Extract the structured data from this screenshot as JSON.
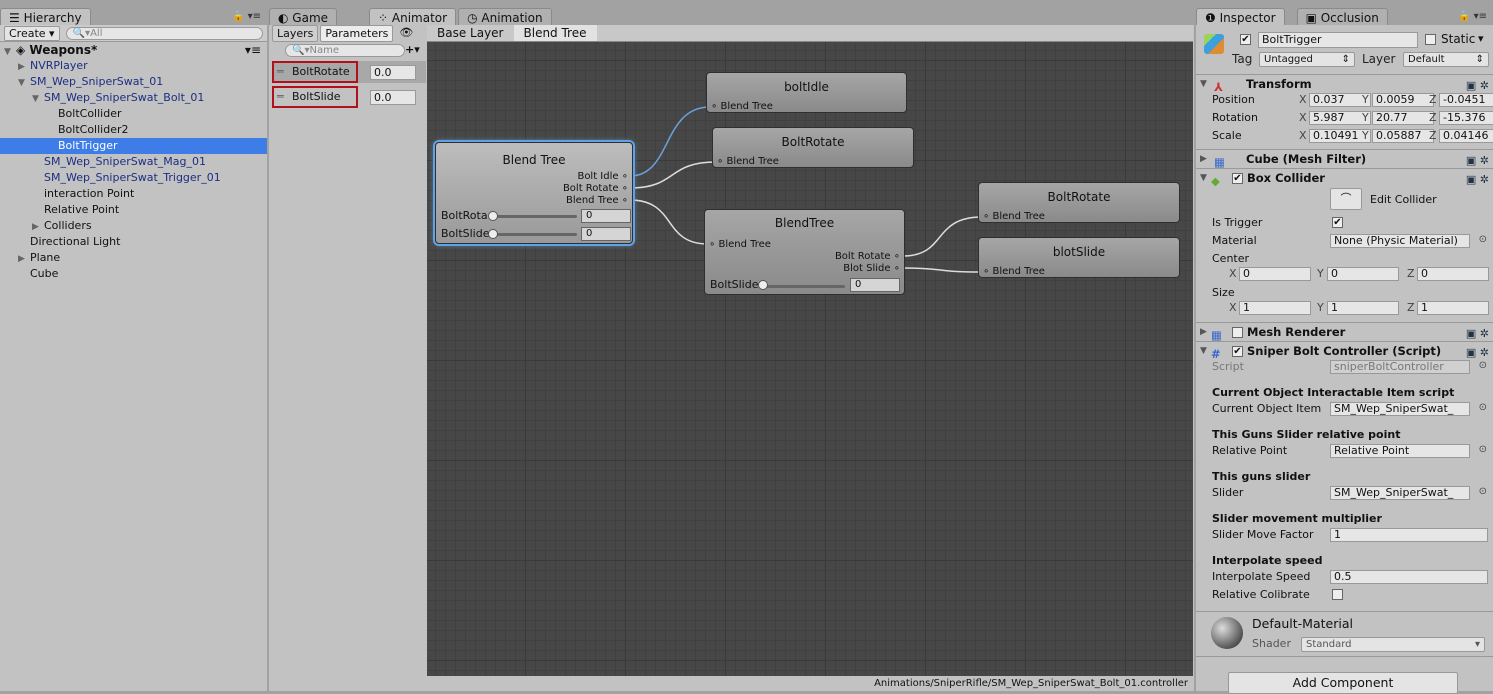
{
  "hierarchy": {
    "tab": "Hierarchy",
    "create": "Create",
    "search_placeholder": "All",
    "scene": "Weapons*",
    "items": [
      {
        "label": "NVRPlayer",
        "blue": true
      },
      {
        "label": "SM_Wep_SniperSwat_01",
        "blue": true
      },
      {
        "label": "SM_Wep_SniperSwat_Bolt_01",
        "blue": true
      },
      {
        "label": "BoltCollider"
      },
      {
        "label": "BoltCollider2"
      },
      {
        "label": "BoltTrigger",
        "selected": true
      },
      {
        "label": "SM_Wep_SniperSwat_Mag_01",
        "blue": true
      },
      {
        "label": "SM_Wep_SniperSwat_Trigger_01",
        "blue": true
      },
      {
        "label": "interaction Point"
      },
      {
        "label": "Relative Point"
      },
      {
        "label": "Colliders"
      },
      {
        "label": "Directional Light"
      },
      {
        "label": "Plane"
      },
      {
        "label": "Cube"
      }
    ]
  },
  "center_tabs": {
    "game": "Game",
    "animator": "Animator",
    "animation": "Animation"
  },
  "animator": {
    "layers_tab": "Layers",
    "parameters_tab": "Parameters",
    "search_placeholder": "Name",
    "parameters": [
      {
        "name": "BoltRotate",
        "value": "0.0"
      },
      {
        "name": "BoltSlide",
        "value": "0.0"
      }
    ],
    "breadcrumb": [
      "Base Layer",
      "Blend Tree"
    ],
    "status_path": "Animations/SniperRifle/SM_Wep_SniperSwat_Bolt_01.controller",
    "nodes": {
      "root": {
        "title": "Blend Tree",
        "outputs": [
          "Bolt Idle",
          "Bolt Rotate",
          "Blend Tree"
        ],
        "sliders": [
          {
            "label": "BoltRota",
            "value": "0"
          },
          {
            "label": "BoltSlide",
            "value": "0"
          }
        ]
      },
      "boltIdle": {
        "title": "boltIdle",
        "input": "Blend Tree"
      },
      "boltRotate1": {
        "title": "BoltRotate",
        "input": "Blend Tree"
      },
      "sub": {
        "title": "BlendTree",
        "input": "Blend Tree",
        "outputs": [
          "Bolt Rotate",
          "Blot Slide"
        ],
        "slider": {
          "label": "BoltSlide",
          "value": "0"
        }
      },
      "boltRotate2": {
        "title": "BoltRotate",
        "input": "Blend Tree"
      },
      "blotSlide": {
        "title": "blotSlide",
        "input": "Blend Tree"
      }
    },
    "selected_link_color": "#6a9fd8"
  },
  "inspector": {
    "tab": "Inspector",
    "occlusion_tab": "Occlusion",
    "object_name": "BoltTrigger",
    "active": true,
    "static_label": "Static",
    "tag_label": "Tag",
    "tag": "Untagged",
    "layer_label": "Layer",
    "layer": "Default",
    "transform": {
      "title": "Transform",
      "position": {
        "label": "Position",
        "x": "0.037",
        "y": "0.0059",
        "z": "-0.0451"
      },
      "rotation": {
        "label": "Rotation",
        "x": "5.987",
        "y": "20.77",
        "z": "-15.376"
      },
      "scale": {
        "label": "Scale",
        "x": "0.10491",
        "y": "0.05887",
        "z": "0.04146"
      }
    },
    "mesh_filter": {
      "title": "Cube (Mesh Filter)"
    },
    "box_collider": {
      "title": "Box Collider",
      "edit_collider": "Edit Collider",
      "is_trigger_label": "Is Trigger",
      "is_trigger": true,
      "material_label": "Material",
      "material": "None (Physic Material)",
      "center_label": "Center",
      "center": {
        "x": "0",
        "y": "0",
        "z": "0"
      },
      "size_label": "Size",
      "size": {
        "x": "1",
        "y": "1",
        "z": "1"
      }
    },
    "mesh_renderer": {
      "title": "Mesh Renderer",
      "enabled": false
    },
    "script": {
      "title": "Sniper Bolt Controller (Script)",
      "script_label": "Script",
      "script_value": "sniperBoltController",
      "h1": "Current Object Interactable Item script",
      "f1_label": "Current Object Item",
      "f1": "SM_Wep_SniperSwat_",
      "h2": "This Guns Slider relative point",
      "f2_label": "Relative Point",
      "f2": "Relative Point",
      "h3": "This guns slider",
      "f3_label": "Slider",
      "f3": "SM_Wep_SniperSwat_",
      "h4": "Slider movement multiplier",
      "f4_label": "Slider Move Factor",
      "f4": "1",
      "h5": "Interpolate speed",
      "f5_label": "Interpolate Speed",
      "f5": "0.5",
      "f6_label": "Relative Colibrate",
      "f6": false
    },
    "material": {
      "name": "Default-Material",
      "shader_label": "Shader",
      "shader": "Standard"
    },
    "add_component": "Add Component"
  },
  "axis_labels": {
    "x": "X",
    "y": "Y",
    "z": "Z"
  }
}
